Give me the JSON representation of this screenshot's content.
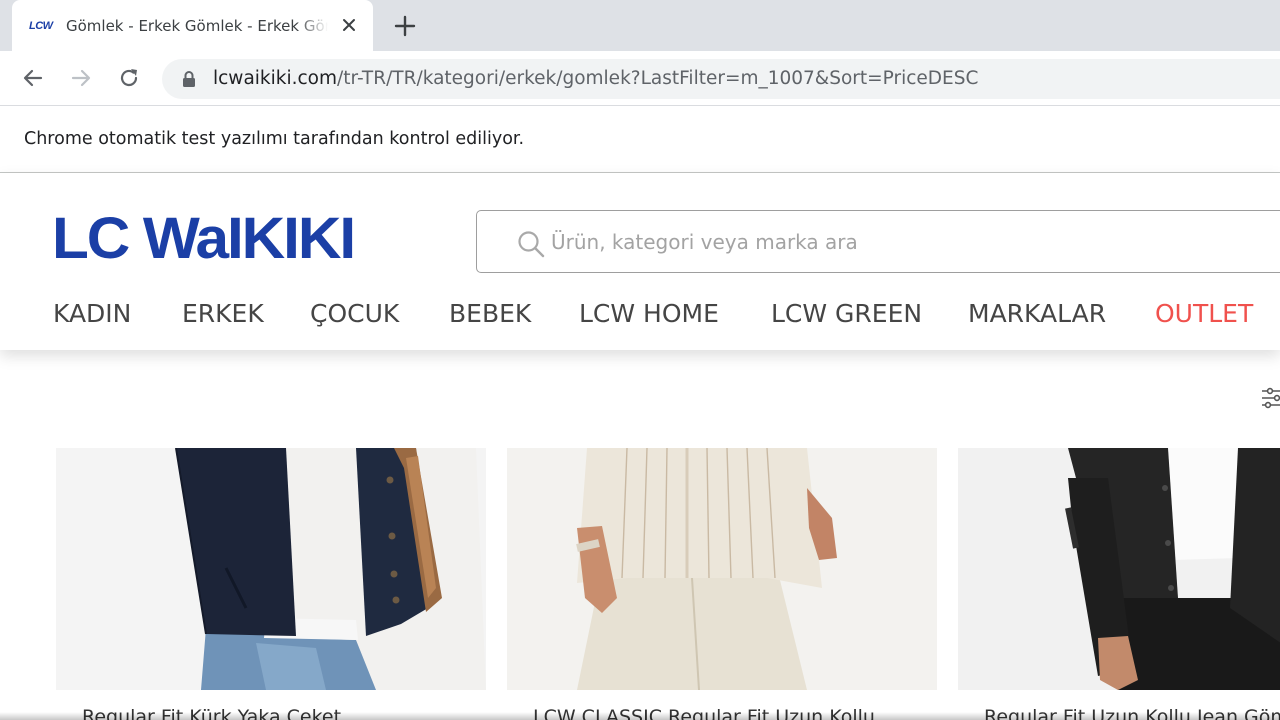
{
  "browser": {
    "tab": {
      "favicon_text": "LCW",
      "title": "Gömlek - Erkek Gömlek - Erkek Gömlek Modelleri"
    },
    "url": {
      "host": "lcwaikiki.com",
      "path": "/tr-TR/TR/kategori/erkek/gomlek?LastFilter=m_1007&Sort=PriceDESC"
    },
    "infobar_text": "Chrome otomatik test yazılımı tarafından kontrol ediliyor."
  },
  "site": {
    "logo_text": "LC WaIKIKI",
    "brand_color": "#1b3fa6",
    "search": {
      "placeholder": "Ürün, kategori veya marka ara",
      "value": ""
    },
    "nav": [
      {
        "label": "KADIN"
      },
      {
        "label": "ERKEK"
      },
      {
        "label": "ÇOCUK"
      },
      {
        "label": "BEBEK"
      },
      {
        "label": "LCW HOME"
      },
      {
        "label": "LCW GREEN"
      },
      {
        "label": "MARKALAR"
      },
      {
        "label": "OUTLET",
        "color": "#f0514d"
      }
    ]
  },
  "products": [
    {
      "title": "Regular Fit Kürk Yaka Ceket"
    },
    {
      "title": "LCW CLASSIC Regular Fit Uzun Kollu"
    },
    {
      "title": "Regular Fit Uzun Kollu Jean Gömlek"
    }
  ]
}
